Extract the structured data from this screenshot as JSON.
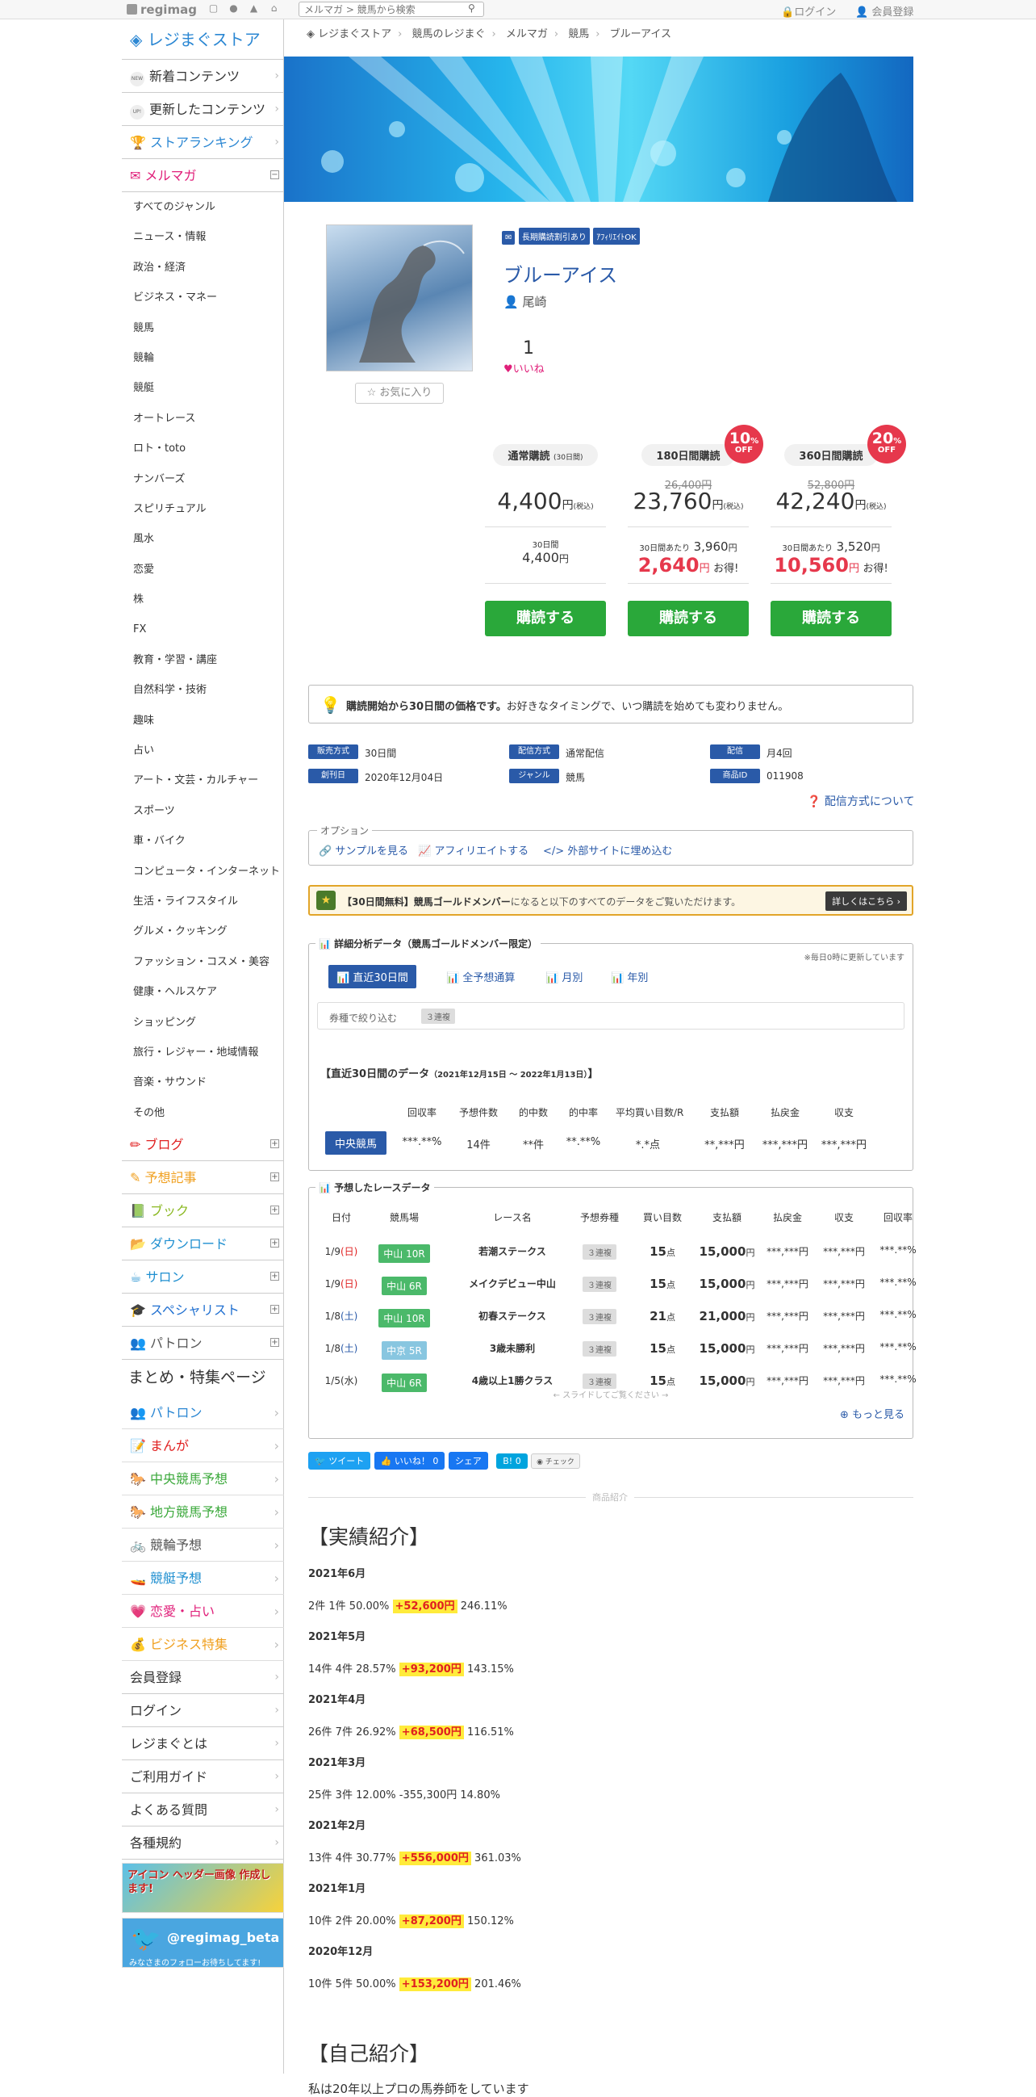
{
  "topbar": {
    "logo": "regimag",
    "search_placeholder": "メルマガ > 競馬から検索",
    "login": "ログイン",
    "register": "会員登録"
  },
  "sidebar": {
    "store_title": "レジまぐストア",
    "main_items": [
      {
        "tag": "NEW",
        "label": "新着コンテンツ"
      },
      {
        "tag": "UP!",
        "label": "更新したコンテンツ"
      },
      {
        "label": "ストアランキング"
      },
      {
        "label": "メルマガ"
      }
    ],
    "genres": [
      "すべてのジャンル",
      "ニュース・情報",
      "政治・経済",
      "ビジネス・マネー",
      "競馬",
      "競輪",
      "競艇",
      "オートレース",
      "ロト・toto",
      "ナンバーズ",
      "スピリチュアル",
      "風水",
      "恋愛",
      "株",
      "FX",
      "教育・学習・講座",
      "自然科学・技術",
      "趣味",
      "占い",
      "アート・文芸・カルチャー",
      "スポーツ",
      "車・バイク",
      "コンピュータ・インターネット",
      "生活・ライフスタイル",
      "グルメ・クッキング",
      "ファッション・コスメ・美容",
      "健康・ヘルスケア",
      "ショッピング",
      "旅行・レジャー・地域情報",
      "音楽・サウンド",
      "その他"
    ],
    "categories": [
      {
        "label": "ブログ",
        "color": "#e02020"
      },
      {
        "label": "予想記事",
        "color": "#f0a020"
      },
      {
        "label": "ブック",
        "color": "#8ab820"
      },
      {
        "label": "ダウンロード",
        "color": "#1f8fd0"
      },
      {
        "label": "サロン",
        "color": "#1f8fd0"
      },
      {
        "label": "スペシャリスト",
        "color": "#1f6fd0"
      },
      {
        "label": "パトロン",
        "color": "#555555"
      }
    ],
    "special_title": "まとめ・特集ページ",
    "specials": [
      {
        "label": "パトロン",
        "color": "#2b87d3"
      },
      {
        "label": "まんが",
        "color": "#e02020"
      },
      {
        "label": "中央競馬予想",
        "color": "#3aa83a"
      },
      {
        "label": "地方競馬予想",
        "color": "#3aa83a"
      },
      {
        "label": "競輪予想",
        "color": "#555555"
      },
      {
        "label": "競艇予想",
        "color": "#1f8fd0"
      },
      {
        "label": "恋愛・占い",
        "color": "#e0207a"
      },
      {
        "label": "ビジネス特集",
        "color": "#f0a020"
      }
    ],
    "links": [
      "会員登録",
      "ログイン",
      "レジまぐとは",
      "ご利用ガイド",
      "よくある質問",
      "各種規約"
    ],
    "banner1": "アイコン ヘッダー画像 作成します!",
    "banner2": "@regimag_beta",
    "banner2_sub": "みなさまのフォローお待ちしてます!"
  },
  "breadcrumb": [
    "レジまぐストア",
    "競馬のレジまぐ",
    "メルマガ",
    "競馬",
    "ブルーアイス"
  ],
  "product": {
    "badges": [
      "長期購読割引あり",
      "ｱﾌｨﾘｴｲﾄOK"
    ],
    "title": "ブルーアイス",
    "author": "尾崎",
    "likes": "1",
    "like_label": "いいね",
    "favorite": "お気に入り"
  },
  "plans": [
    {
      "label": "通常購読",
      "sub": "(30日間)",
      "price": "4,400",
      "unit": "円",
      "tax": "(税込)",
      "per_label": "30日間",
      "per_price": "4,400",
      "per_unit": "円",
      "button": "購読する"
    },
    {
      "label": "180日間購読",
      "strike": "26,400円",
      "price": "23,760",
      "unit": "円",
      "tax": "(税込)",
      "per_label": "30日間あたり",
      "per_price": "3,960",
      "per_unit": "円",
      "save": "2,640",
      "save_unit": "円",
      "save_note": "お得!",
      "off": "10",
      "button": "購読する"
    },
    {
      "label": "360日間購読",
      "strike": "52,800円",
      "price": "42,240",
      "unit": "円",
      "tax": "(税込)",
      "per_label": "30日間あたり",
      "per_price": "3,520",
      "per_unit": "円",
      "save": "10,560",
      "save_unit": "円",
      "save_note": "お得!",
      "off": "20",
      "button": "購読する"
    }
  ],
  "notice": {
    "bold": "購読開始から30日間の価格です。",
    "text": "お好きなタイミングで、いつ購読を始めても変わりません。"
  },
  "info": [
    {
      "label": "販売方式",
      "value": "30日間"
    },
    {
      "label": "配信方式",
      "value": "通常配信"
    },
    {
      "label": "配信",
      "value": "月4回"
    },
    {
      "label": "創刊日",
      "value": "2020年12月04日"
    },
    {
      "label": "ジャンル",
      "value": "競馬"
    },
    {
      "label": "商品ID",
      "value": "011908"
    }
  ],
  "delivery_link": "配信方式について",
  "options": {
    "legend": "オプション",
    "items": [
      "サンプルを見る",
      "アフィリエイトする",
      "外部サイトに埋め込む"
    ]
  },
  "gold": {
    "bold": "【30日間無料】競馬ゴールドメンバー",
    "text": "になると以下のすべてのデータをご覧いただけます。",
    "button": "詳しくはこちら"
  },
  "analysis": {
    "legend": "詳細分析データ（競馬ゴールドメンバー限定）",
    "note": "※毎日0時に更新しています",
    "tabs": [
      "直近30日間",
      "全予想通算",
      "月別",
      "年別"
    ],
    "filter_label": "券種で絞り込む",
    "filter_tag": "３連複",
    "period_title": "【直近30日間のデータ",
    "period_range": "（2021年12月15日 〜 2022年1月13日）",
    "headers": [
      "回収率",
      "予想件数",
      "的中数",
      "的中率",
      "平均買い目数/R",
      "支払額",
      "払戻金",
      "収支"
    ],
    "row_label": "中央競馬",
    "row": [
      "***.**%",
      "14件",
      "**件",
      "**.**%",
      "*.*点",
      "**,***円",
      "***,***円",
      "***,***円"
    ]
  },
  "races": {
    "legend": "予想したレースデータ",
    "headers": [
      "日付",
      "競馬場",
      "レース名",
      "予想券種",
      "買い目数",
      "支払額",
      "払戻金",
      "収支",
      "回収率"
    ],
    "rows": [
      {
        "date": "1/9",
        "dow": "(日)",
        "track": "中山 10R",
        "name": "若潮ステークス",
        "type": "３連複",
        "count": "15",
        "pay": "15,000",
        "back": "***,***円",
        "bal": "***,***円",
        "rate": "***.**%"
      },
      {
        "date": "1/9",
        "dow": "(日)",
        "track": "中山 6R",
        "name": "メイクデビュー中山",
        "type": "３連複",
        "count": "15",
        "pay": "15,000",
        "back": "***,***円",
        "bal": "***,***円",
        "rate": "***.**%"
      },
      {
        "date": "1/8",
        "dow": "(土)",
        "track": "中山 10R",
        "name": "初春ステークス",
        "type": "３連複",
        "count": "21",
        "pay": "21,000",
        "back": "***,***円",
        "bal": "***,***円",
        "rate": "***.**%"
      },
      {
        "date": "1/8",
        "dow": "(土)",
        "track": "中京 5R",
        "name": "3歳未勝利",
        "type": "３連複",
        "count": "15",
        "pay": "15,000",
        "back": "***,***円",
        "bal": "***,***円",
        "rate": "***.**%"
      },
      {
        "date": "1/5",
        "dow": "(水)",
        "track": "中山 6R",
        "name": "4歳以上1勝クラス",
        "type": "３連複",
        "count": "15",
        "pay": "15,000",
        "back": "***,***円",
        "bal": "***,***円",
        "rate": "***.**%"
      }
    ],
    "scroll_hint": "← スライドしてご覧ください →",
    "more": "もっと見る",
    "unit_pt": "点",
    "unit_yen": "円"
  },
  "social": {
    "tweet": "ツイート",
    "like": "いいね！ 0",
    "share": "シェア",
    "hatena": "B! 0",
    "check": "チェック"
  },
  "intro": {
    "divider": "商品紹介",
    "heading1": "【実績紹介】",
    "results": [
      {
        "month": "2021年6月",
        "pre": "2件 1件 50.00%",
        "hl": "+52,600円",
        "post": "246.11%"
      },
      {
        "month": "2021年5月",
        "pre": "14件 4件 28.57%",
        "hl": "+93,200円",
        "post": "143.15%"
      },
      {
        "month": "2021年4月",
        "pre": "26件 7件 26.92%",
        "hl": "+68,500円",
        "post": "116.51%"
      },
      {
        "month": "2021年3月",
        "pre": "25件 3件 12.00%",
        "hl": "",
        "post": "-355,300円 14.80%"
      },
      {
        "month": "2021年2月",
        "pre": "13件 4件 30.77%",
        "hl": "+556,000円",
        "post": "361.03%"
      },
      {
        "month": "2021年1月",
        "pre": "10件 2件 20.00%",
        "hl": "+87,200円",
        "post": "150.12%"
      },
      {
        "month": "2020年12月",
        "pre": "10件 5件 50.00%",
        "hl": "+153,200円",
        "post": "201.46%"
      }
    ],
    "heading2": "【自己紹介】",
    "self_text": "私は20年以上プロの馬券師をしています"
  }
}
